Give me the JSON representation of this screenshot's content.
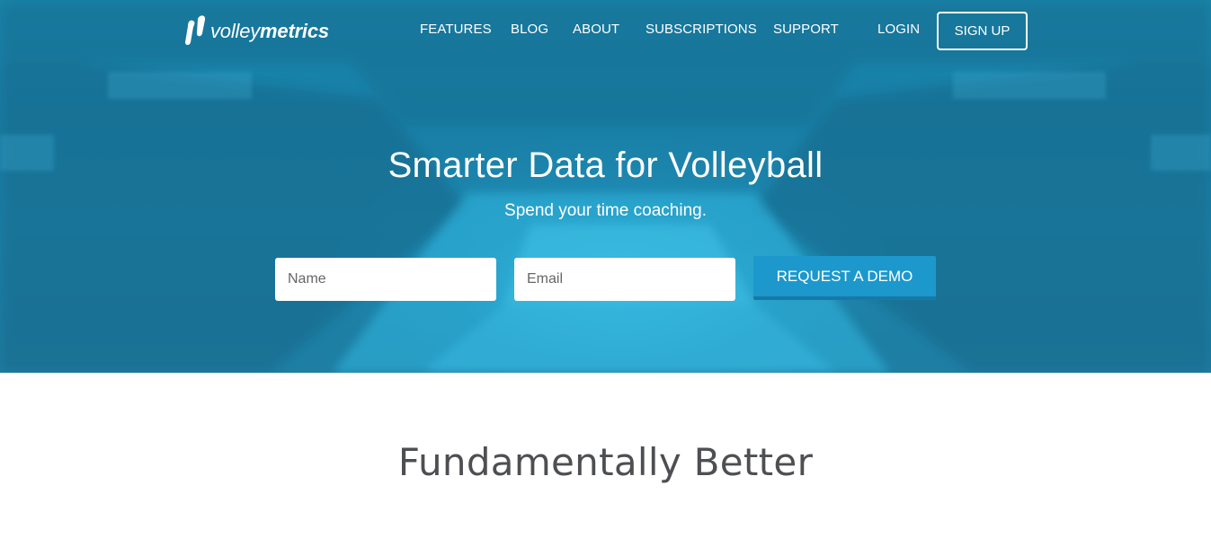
{
  "brand": {
    "logo_light": "volley",
    "logo_bold": "metrics"
  },
  "nav": {
    "items": [
      {
        "label": "FEATURES"
      },
      {
        "label": "BLOG"
      },
      {
        "label": "ABOUT"
      },
      {
        "label": "SUBSCRIPTIONS"
      },
      {
        "label": "SUPPORT"
      }
    ],
    "login": "LOGIN",
    "signup": "SIGN UP"
  },
  "hero": {
    "title": "Smarter Data for Volleyball",
    "subtitle": "Spend your time coaching.",
    "form": {
      "name_placeholder": "Name",
      "email_placeholder": "Email",
      "submit_label": "REQUEST A DEMO"
    }
  },
  "section": {
    "title": "Fundamentally Better"
  },
  "colors": {
    "hero_overlay": "#1a87ad",
    "button": "#1c98cc",
    "heading_dark": "#4d4f52"
  }
}
